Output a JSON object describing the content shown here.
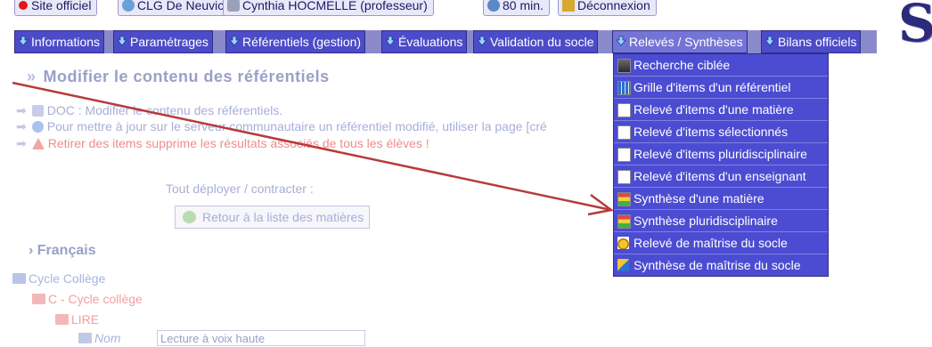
{
  "topbar": {
    "site_officiel": "Site officiel",
    "etablissement": "CLG De Neuvic",
    "user": "Cynthia HOCMELLE (professeur)",
    "timer": "80 min.",
    "deconnexion": "Déconnexion"
  },
  "menu": {
    "items": [
      {
        "label": "Informations"
      },
      {
        "label": "Paramétrages"
      },
      {
        "label": "Référentiels (gestion)"
      },
      {
        "label": "Évaluations"
      },
      {
        "label": "Validation du socle"
      },
      {
        "label": "Relevés / Synthèses"
      },
      {
        "label": "Bilans officiels"
      }
    ],
    "active_index": 5
  },
  "dropdown": {
    "items": [
      {
        "label": "Recherche ciblée",
        "icon": "search-icon"
      },
      {
        "label": "Grille d'items d'un référentiel",
        "icon": "grid-icon"
      },
      {
        "label": "Relevé d'items d'une matière",
        "icon": "document-icon"
      },
      {
        "label": "Relevé d'items sélectionnés",
        "icon": "document-icon"
      },
      {
        "label": "Relevé d'items pluridisciplinaire",
        "icon": "document-icon"
      },
      {
        "label": "Relevé d'items d'un enseignant",
        "icon": "document-icon"
      },
      {
        "label": "Synthèse d'une matière",
        "icon": "synthesis-icon"
      },
      {
        "label": "Synthèse pluridisciplinaire",
        "icon": "synthesis-icon"
      },
      {
        "label": "Relevé de maîtrise du socle",
        "icon": "medal-icon"
      },
      {
        "label": "Synthèse de maîtrise du socle",
        "icon": "medal-synthesis-icon"
      }
    ]
  },
  "content": {
    "title": "Modifier le contenu des référentiels",
    "doc_link": "DOC : Modifier le contenu des référentiels.",
    "info_line": "Pour mettre à jour sur le serveur communautaire un référentiel modifié, utiliser la page [cré",
    "warning_line": "Retirer des items supprime les résultats associés de tous les élèves !",
    "deploy_label": "Tout déployer / contracter :",
    "back_button": "Retour à la liste des matières",
    "subject": "Français",
    "tree": {
      "level1": "Cycle Collège",
      "level2": "C - Cycle collège",
      "level3": "LIRE",
      "name_label": "Nom",
      "name_value": "Lecture à voix haute"
    }
  },
  "colors": {
    "menu_bg": "#4c4cc9",
    "menu_active": "#7474d6",
    "dropdown_bg": "#4c4cd2",
    "annotation_arrow": "#b83a3a"
  }
}
